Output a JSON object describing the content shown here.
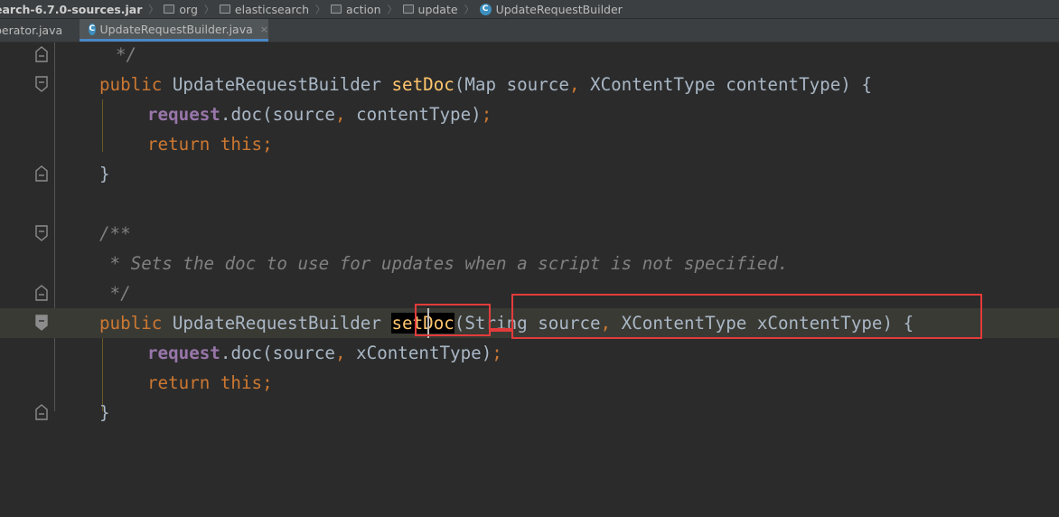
{
  "breadcrumb": {
    "items": [
      {
        "label": "earch-6.7.0-sources.jar",
        "icon": "none"
      },
      {
        "label": "org",
        "icon": "folder-icon"
      },
      {
        "label": "elasticsearch",
        "icon": "folder-icon"
      },
      {
        "label": "action",
        "icon": "folder-icon"
      },
      {
        "label": "update",
        "icon": "folder-icon"
      },
      {
        "label": "UpdateRequestBuilder",
        "icon": "class-icon"
      }
    ],
    "separator": "〉"
  },
  "tabs": [
    {
      "label": "perator.java",
      "active": false
    },
    {
      "label": "UpdateRequestBuilder.java",
      "active": true,
      "close": "×"
    }
  ],
  "code": {
    "line1": "*/",
    "line2": {
      "kw": "public",
      "type": "UpdateRequestBuilder",
      "method": "setDoc",
      "p1type": "Map",
      "p1": "source",
      "p2type": "XContentType",
      "p2": "contentType",
      "open": "{"
    },
    "line3": {
      "field": "request",
      "call": "doc",
      "a1": "source",
      "a2": "contentType"
    },
    "line4": {
      "kw": "return",
      "this": "this"
    },
    "line5": "}",
    "line7": "/**",
    "line8": " * Sets the doc to use for updates when a script is not specified.",
    "line9": " */",
    "line10": {
      "kw": "public",
      "type": "UpdateRequestBuilder",
      "method": "setDoc",
      "p1type": "String",
      "p1": "source",
      "p2type": "XContentType",
      "p2": "xContentType",
      "open": "{"
    },
    "line11": {
      "field": "request",
      "call": "doc",
      "a1": "source",
      "a2": "xContentType"
    },
    "line12": {
      "kw": "return",
      "this": "this"
    },
    "line13": "}"
  },
  "colors": {
    "keyword": "#cc7832",
    "method": "#ffc66d",
    "field": "#9876aa",
    "comment": "#808080",
    "highlight_box": "#e33b3b"
  }
}
